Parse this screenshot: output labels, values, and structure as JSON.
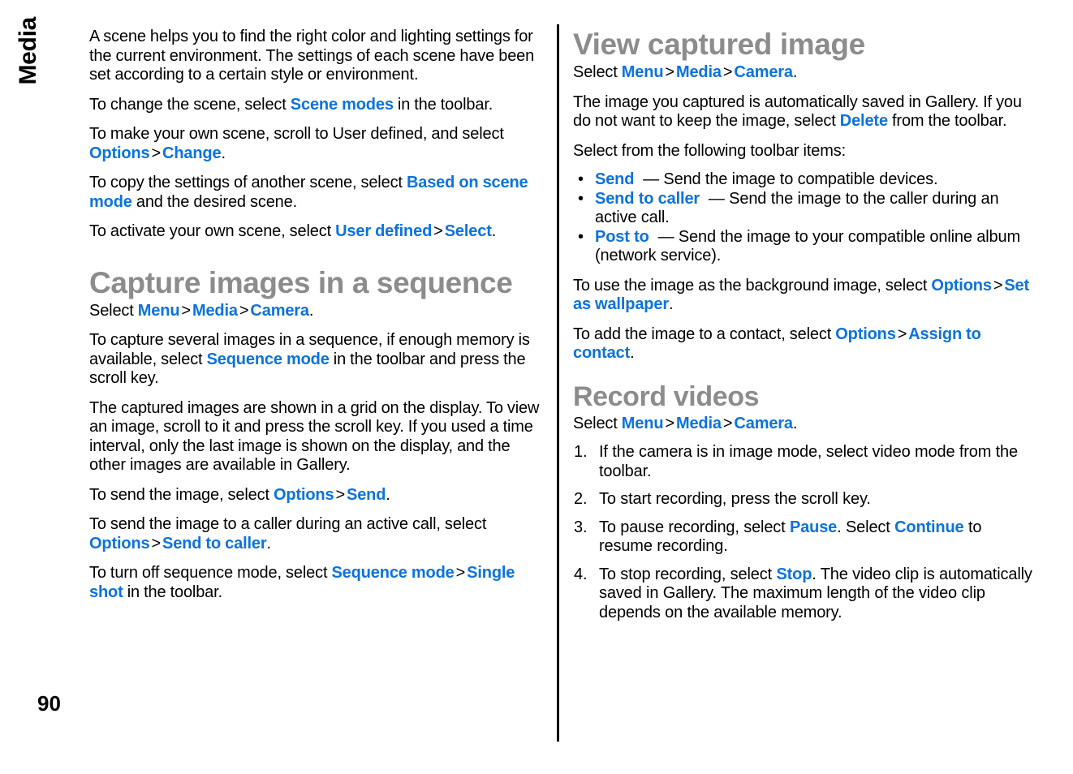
{
  "document": {
    "side_tab_label": "Media",
    "page_number": "90",
    "colors": {
      "link": "#0b72e0",
      "heading": "#8c8c8c",
      "body": "#000000",
      "background": "#ffffff"
    }
  },
  "left_column": {
    "intro_paragraph": "A scene helps you to find the right color and lighting settings for the current environment. The settings of each scene have been set according to a certain style or environment.",
    "change_scene": {
      "before": "To change the scene, select ",
      "link": "Scene modes",
      "after": " in the toolbar."
    },
    "own_scene": {
      "before": "To make your own scene, scroll to User defined, and select ",
      "link1": "Options",
      "sep": ">",
      "link2": "Change",
      "after": "."
    },
    "copy_settings": {
      "before": "To copy the settings of another scene, select ",
      "link": "Based on scene mode",
      "after": " and the desired scene."
    },
    "activate_scene": {
      "before": "To activate your own scene, select ",
      "link1": "User defined",
      "sep": ">",
      "link2": "Select",
      "after": "."
    },
    "heading_capture": "Capture images in a sequence",
    "select_path": {
      "before": "Select ",
      "link1": "Menu",
      "sep1": ">",
      "link2": "Media",
      "sep2": ">",
      "link3": "Camera",
      "after": "."
    },
    "sequence_intro": {
      "before": "To capture several images in a sequence, if enough memory is available, select ",
      "link": "Sequence mode",
      "after": " in the toolbar and press the scroll key."
    },
    "grid_paragraph": "The captured images are shown in a grid on the display. To view an image, scroll to it and press the scroll key. If you used a time interval, only the last image is shown on the display, and the other images are available in Gallery.",
    "send_image": {
      "before": "To send the image, select ",
      "link1": "Options",
      "sep": ">",
      "link2": "Send",
      "after": "."
    },
    "send_to_caller": {
      "before": "To send the image to a caller during an active call, select ",
      "link1": "Options",
      "sep": ">",
      "link2": "Send to caller",
      "after": "."
    },
    "turn_off_sequence": {
      "before": "To turn off sequence mode, select ",
      "link1": "Sequence mode",
      "sep": ">",
      "link2": "Single shot",
      "after": " in the toolbar."
    }
  },
  "right_column": {
    "heading_view": "View captured image",
    "select_path_view": {
      "before": "Select ",
      "link1": "Menu",
      "sep1": ">",
      "link2": "Media",
      "sep2": ">",
      "link3": "Camera",
      "after": "."
    },
    "auto_saved": {
      "before": "The image you captured is automatically saved in Gallery. If you do not want to keep the image, select ",
      "link": "Delete",
      "after": " from the toolbar."
    },
    "toolbar_intro": "Select from the following toolbar items:",
    "toolbar_items": [
      {
        "marker": "•",
        "link": "Send",
        "dash": "—",
        "text": "Send the image to compatible devices."
      },
      {
        "marker": "•",
        "link": "Send to caller",
        "dash": "—",
        "text": "Send the image to the caller during an active call."
      },
      {
        "marker": "•",
        "link": "Post to",
        "dash": "—",
        "text": "Send the image to your compatible online album (network service)."
      }
    ],
    "wallpaper": {
      "before": "To use the image as the background image, select ",
      "link1": "Options",
      "sep": ">",
      "link2": "Set as wallpaper",
      "after": "."
    },
    "assign_contact": {
      "before": "To add the image to a contact, select ",
      "link1": "Options",
      "sep": ">",
      "link2": "Assign to contact",
      "after": "."
    },
    "heading_record": "Record videos",
    "select_path_record": {
      "before": "Select ",
      "link1": "Menu",
      "sep1": ">",
      "link2": "Media",
      "sep2": ">",
      "link3": "Camera",
      "after": "."
    },
    "steps": [
      {
        "num": "1.",
        "text": "If the camera is in image mode, select video mode from the toolbar."
      },
      {
        "num": "2.",
        "text": "To start recording, press the scroll key."
      },
      {
        "num": "3.",
        "before": "To pause recording, select ",
        "link1": "Pause",
        "mid": ". Select ",
        "link2": "Continue",
        "after": " to resume recording."
      },
      {
        "num": "4.",
        "before": "To stop recording, select ",
        "link1": "Stop",
        "after": ". The video clip is automatically saved in Gallery. The maximum length of the video clip depends on the available memory."
      }
    ]
  }
}
